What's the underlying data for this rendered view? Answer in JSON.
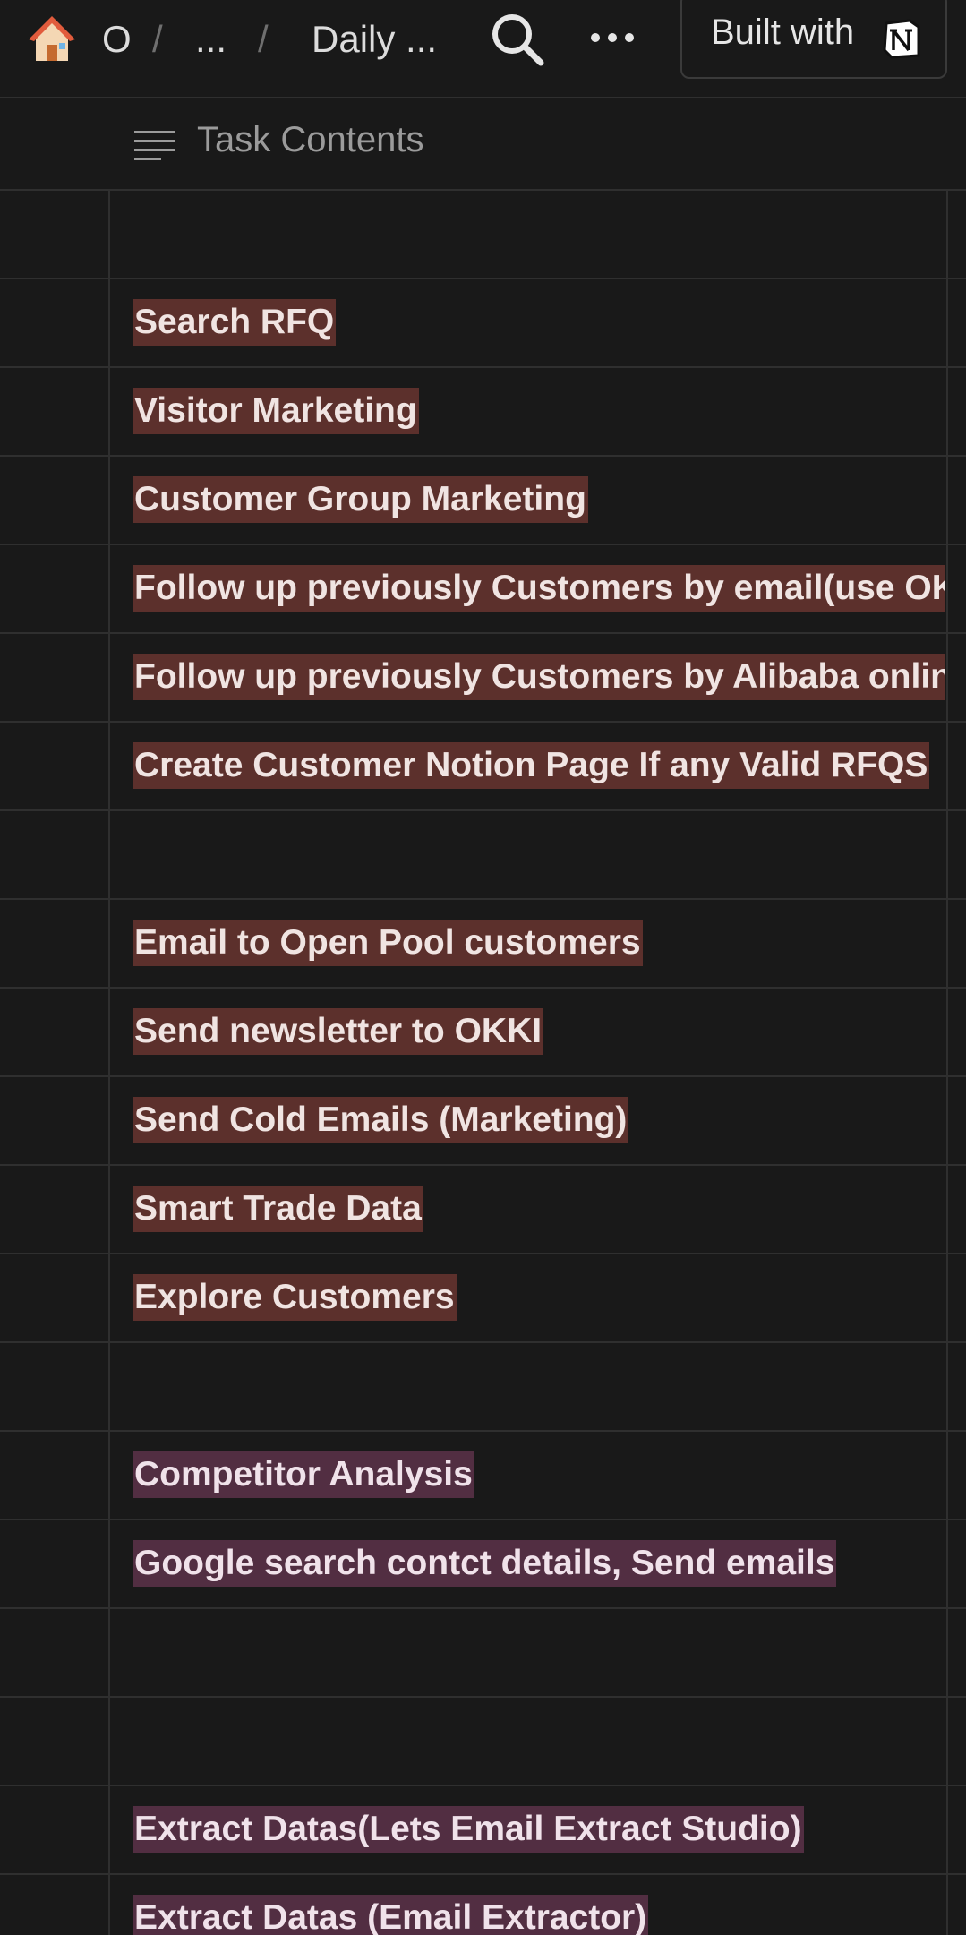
{
  "breadcrumb": {
    "workspace": "O",
    "ellipsis": "...",
    "page": "Daily ...",
    "separator": "/"
  },
  "toolbar": {
    "built_with_label": "Built with",
    "icons": [
      "home-icon",
      "search-icon",
      "more-icon",
      "notion-logo-icon"
    ]
  },
  "table": {
    "column_title": "Task Contents",
    "column_icon": "text-lines-icon",
    "rows": [
      {
        "text": "",
        "tag": "none"
      },
      {
        "text": "Search RFQ",
        "tag": "red"
      },
      {
        "text": "Visitor Marketing",
        "tag": "red"
      },
      {
        "text": "Customer Group Marketing",
        "tag": "red"
      },
      {
        "text": "Follow up previously Customers by email(use OK",
        "tag": "red"
      },
      {
        "text": "Follow up previously Customers by Alibaba onlin",
        "tag": "red"
      },
      {
        "text": "Create Customer Notion Page If any Valid RFQS",
        "tag": "red"
      },
      {
        "text": "",
        "tag": "none"
      },
      {
        "text": "Email to Open Pool customers",
        "tag": "red"
      },
      {
        "text": "Send newsletter to OKKI",
        "tag": "red"
      },
      {
        "text": "Send Cold Emails (Marketing)",
        "tag": "red"
      },
      {
        "text": "Smart Trade Data",
        "tag": "red"
      },
      {
        "text": "Explore Customers",
        "tag": "red"
      },
      {
        "text": "",
        "tag": "none"
      },
      {
        "text": "Competitor Analysis",
        "tag": "purple"
      },
      {
        "text": "Google search contct details, Send emails",
        "tag": "purple"
      },
      {
        "text": "",
        "tag": "none"
      },
      {
        "text": "",
        "tag": "none"
      },
      {
        "text": "Extract Datas(Lets Email Extract Studio)",
        "tag": "purple"
      },
      {
        "text": "Extract Datas (Email Extractor)",
        "tag": "purple"
      }
    ]
  },
  "colors": {
    "background": "#191919",
    "tag_red": "#5c302c",
    "tag_purple": "#522e42",
    "divider": "#2f2f2f"
  }
}
